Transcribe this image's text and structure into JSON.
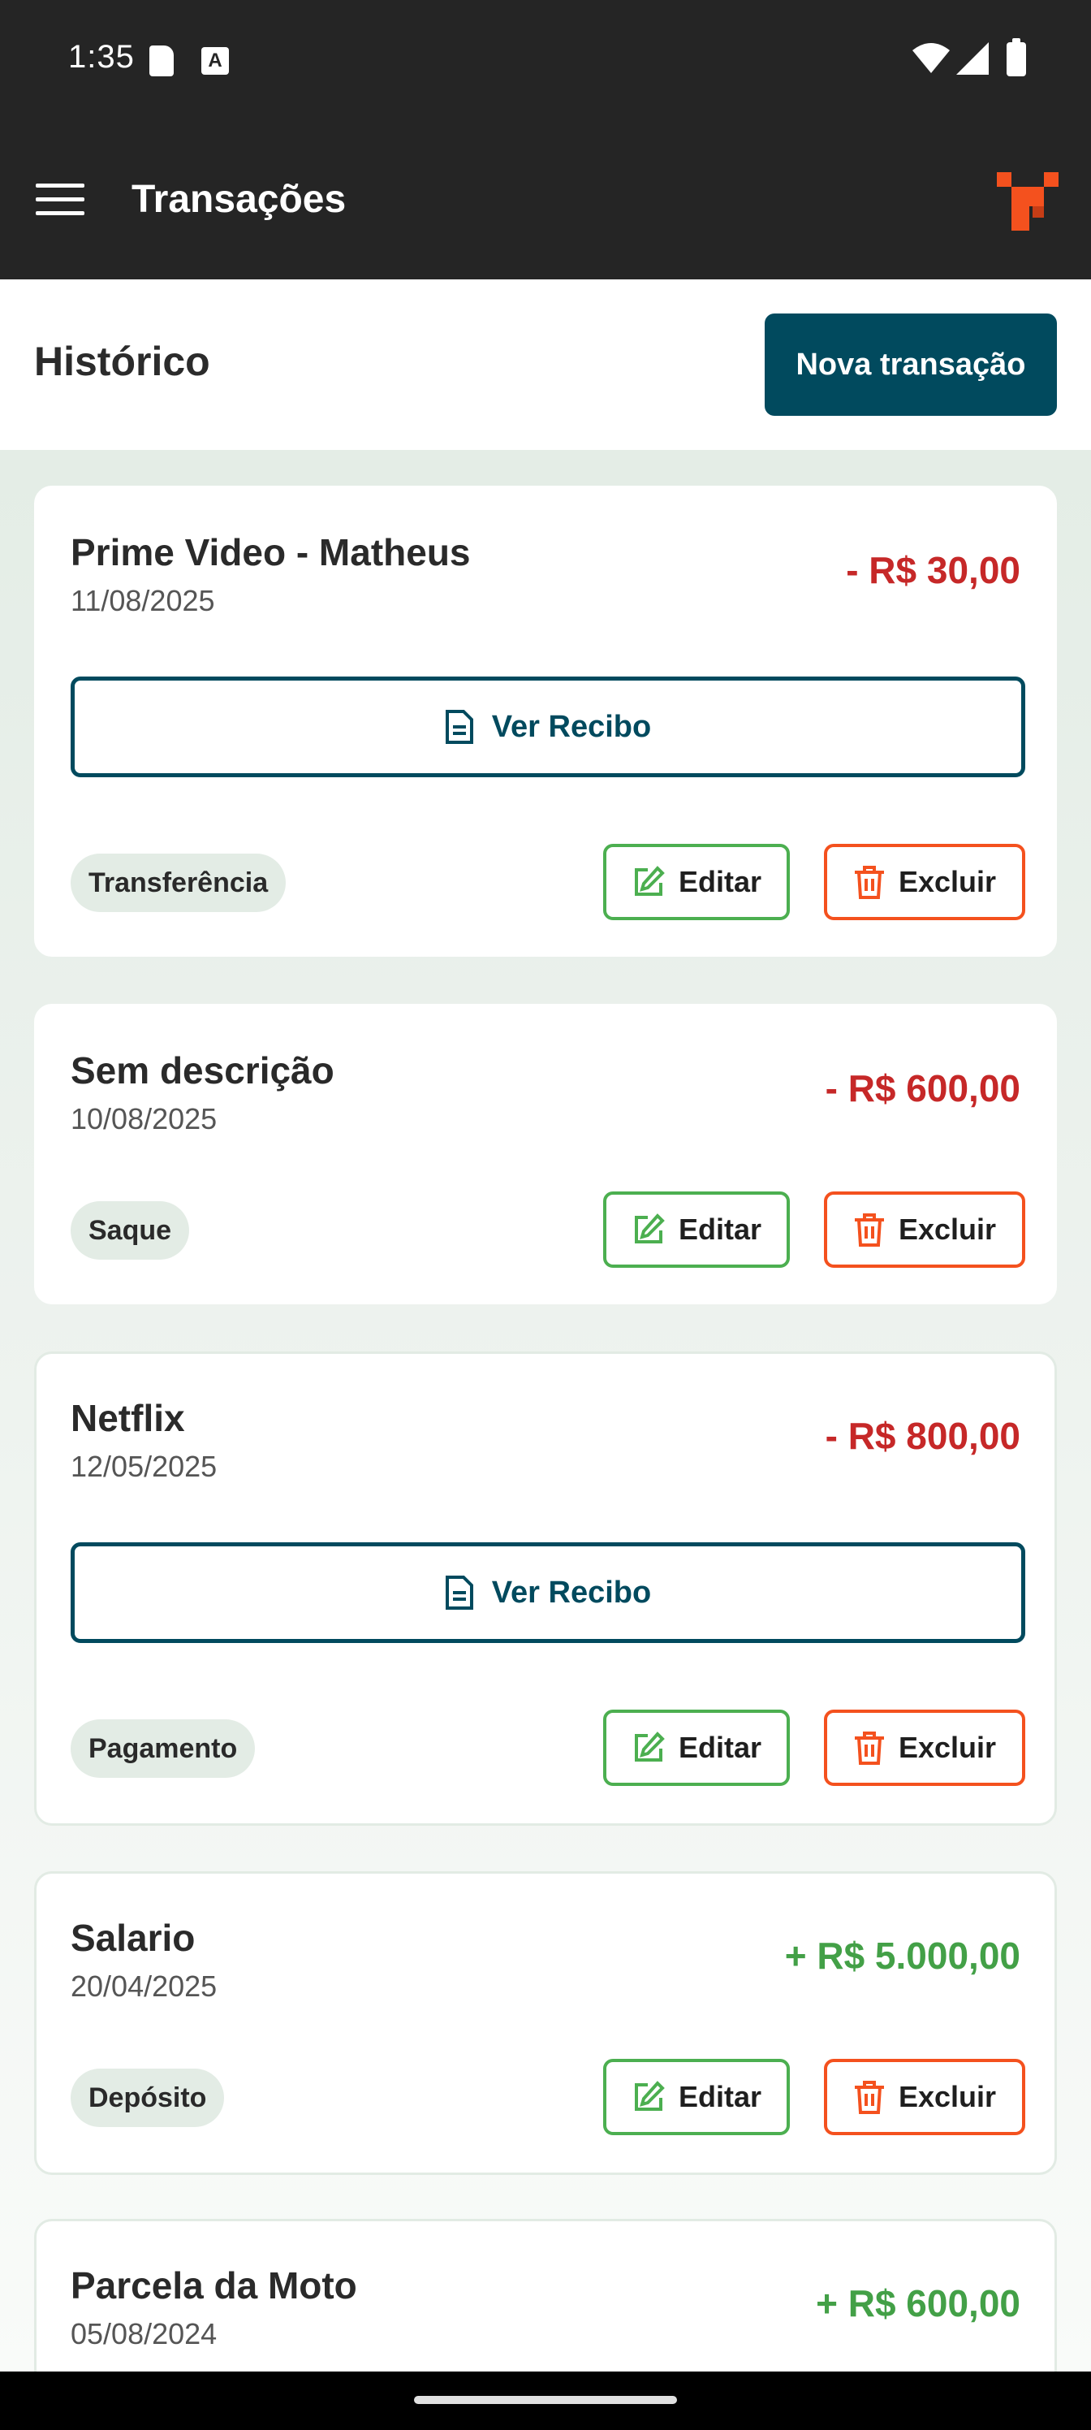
{
  "status_bar": {
    "time": "1:35",
    "icons": [
      "sd-card-icon",
      "a-icon",
      "wifi-icon",
      "signal-icon",
      "battery-icon"
    ],
    "a_glyph": "A"
  },
  "app_bar": {
    "title": "Transações",
    "icons": [
      "menu-icon",
      "app-logo-icon"
    ],
    "accent": "#f4511e"
  },
  "header": {
    "heading": "Histórico",
    "new_button": "Nova transação",
    "button_color": "#014a5e"
  },
  "transactions": [
    {
      "title": "Prime Video - Matheus",
      "date": "11/08/2025",
      "amount": "- R$ 30,00",
      "type": "Transferência",
      "receipt": "Ver Recibo",
      "edit": "Editar",
      "delete": "Excluir"
    },
    {
      "title": "Sem descrição",
      "date": "10/08/2025",
      "amount": "- R$ 600,00",
      "type": "Saque",
      "edit": "Editar",
      "delete": "Excluir"
    },
    {
      "title": "Netflix",
      "date": "12/05/2025",
      "amount": "- R$ 800,00",
      "type": "Pagamento",
      "receipt": "Ver Recibo",
      "edit": "Editar",
      "delete": "Excluir"
    },
    {
      "title": "Salario",
      "date": "20/04/2025",
      "amount": "+ R$ 5.000,00",
      "type": "Depósito",
      "edit": "Editar",
      "delete": "Excluir"
    },
    {
      "title": "Parcela da Moto",
      "date": "05/08/2024",
      "amount": "+ R$ 600,00"
    }
  ],
  "colors": {
    "negative": "#c62828",
    "positive": "#43a047",
    "edit_border": "#4caf50",
    "delete_border": "#f4511e"
  }
}
